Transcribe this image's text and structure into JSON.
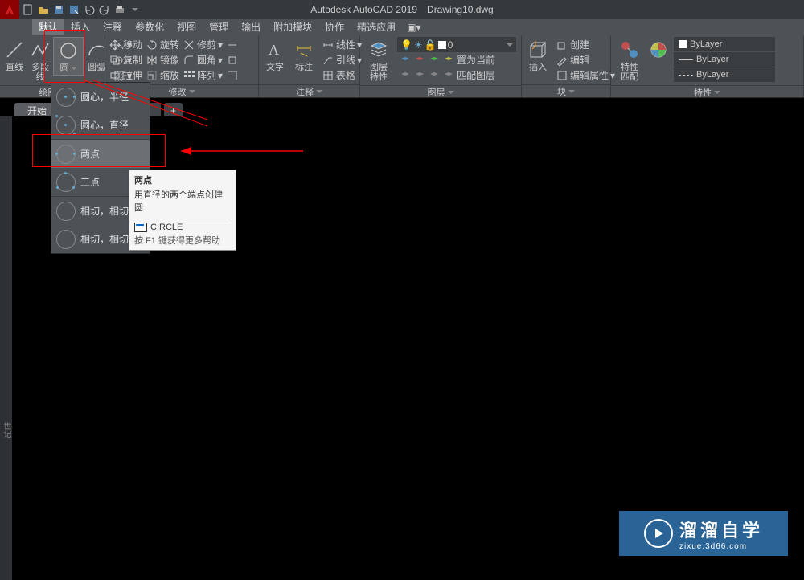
{
  "title": {
    "app": "Autodesk AutoCAD 2019",
    "file": "Drawing10.dwg"
  },
  "menu": {
    "tabs": [
      "默认",
      "插入",
      "注释",
      "参数化",
      "视图",
      "管理",
      "输出",
      "附加模块",
      "协作",
      "精选应用"
    ],
    "active": 0
  },
  "draw": {
    "line": "直线",
    "polyline": "多段线",
    "circle": "圆",
    "arc": "圆弧",
    "panel": "绘图"
  },
  "modify": {
    "move": "移动",
    "copy": "复制",
    "stretch": "拉伸",
    "rotate": "旋转",
    "mirror": "镜像",
    "scale": "缩放",
    "trim": "修剪",
    "fillet": "圆角",
    "array": "阵列",
    "panel": "修改"
  },
  "annot": {
    "text": "文字",
    "dim": "标注",
    "leader": "引线",
    "table": "表格",
    "lin": "线性",
    "panel": "注释"
  },
  "layer": {
    "props": "图层\n特性",
    "current": "置为当前",
    "match": "匹配图层",
    "zero": "0",
    "panel": "图层"
  },
  "block": {
    "insert": "插入",
    "create": "创建",
    "edit": "编辑",
    "editattr": "编辑属性",
    "panel": "块"
  },
  "prop": {
    "match": "特性\n匹配",
    "bylayer": "ByLayer",
    "panel": "特性"
  },
  "doc": {
    "start": "开始",
    "plus": "+"
  },
  "dd": {
    "i1": "圆心，半径",
    "i2": "圆心，直径",
    "i3": "两点",
    "i4": "三点",
    "i5": "相切，相切，",
    "i6": "相切，相切，"
  },
  "tip": {
    "title": "两点",
    "desc": "用直径的两个端点创建圆",
    "cmd": "CIRCLE",
    "help": "按 F1 键获得更多帮助"
  },
  "wm": {
    "big": "溜溜自学",
    "small": "zixue.3d66.com"
  }
}
